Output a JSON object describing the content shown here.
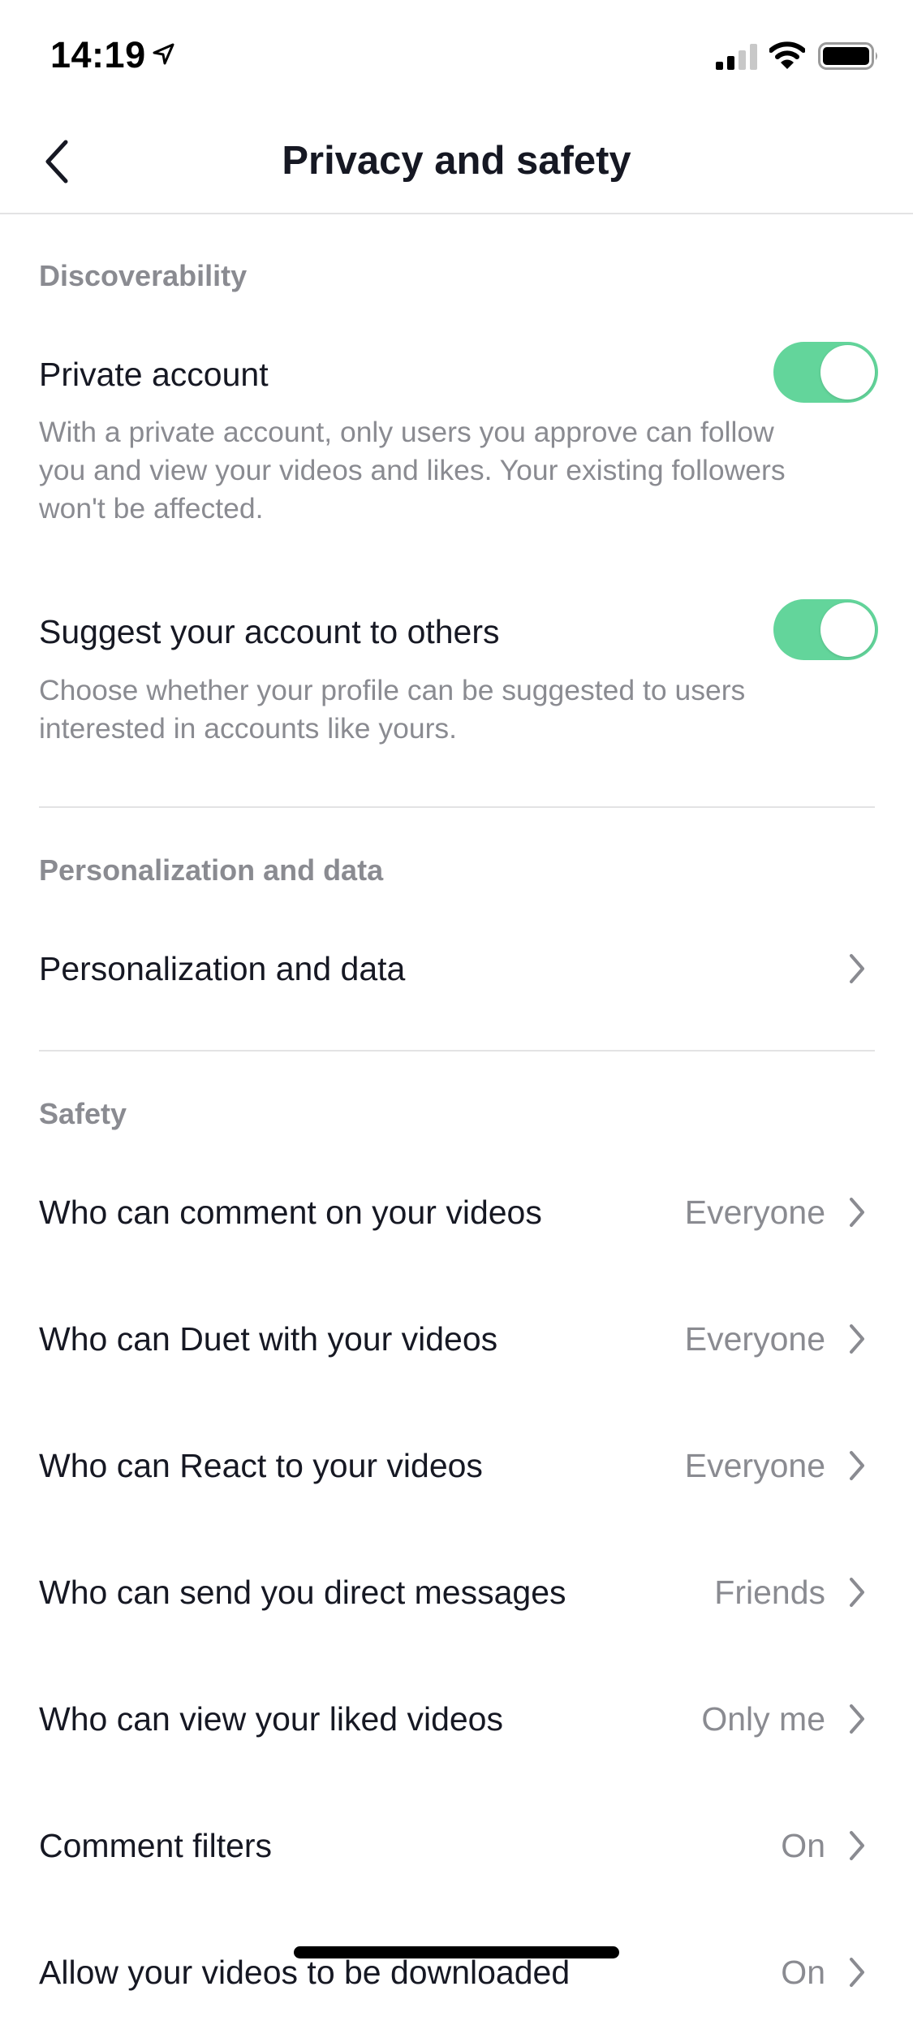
{
  "status_bar": {
    "time": "14:19",
    "location_icon": "location-arrow-icon",
    "signal_bars_filled": 2,
    "signal_bars_total": 4,
    "wifi_icon": "wifi-icon",
    "battery_icon": "battery-icon"
  },
  "header": {
    "back_icon": "chevron-left-icon",
    "title": "Privacy and safety"
  },
  "sections": {
    "discoverability": {
      "title": "Discoverability",
      "private_account": {
        "label": "Private account",
        "enabled": true,
        "description_lines": [
          "With a private account, only users you approve can follow",
          "you and view your videos and likes. Your existing followers",
          "won't be affected."
        ]
      },
      "suggest_account": {
        "label": "Suggest your account to others",
        "enabled": true,
        "description_lines": [
          "Choose whether your profile can be suggested to users",
          "interested in accounts like yours."
        ]
      }
    },
    "personalization": {
      "title": "Personalization and data",
      "items": [
        {
          "label": "Personalization and data"
        }
      ]
    },
    "safety": {
      "title": "Safety",
      "items": [
        {
          "label": "Who can comment on your videos",
          "value": "Everyone"
        },
        {
          "label": "Who can Duet with your videos",
          "value": "Everyone"
        },
        {
          "label": "Who can React to your videos",
          "value": "Everyone"
        },
        {
          "label": "Who can send you direct messages",
          "value": "Friends"
        },
        {
          "label": "Who can view your liked videos",
          "value": "Only me"
        },
        {
          "label": "Comment filters",
          "value": "On"
        },
        {
          "label": "Allow your videos to be downloaded",
          "value": "On"
        }
      ]
    }
  },
  "colors": {
    "toggle_on": "#63d59b",
    "primary_text": "#161823",
    "secondary_text": "#8a8b91",
    "divider": "#e3e3e4"
  }
}
